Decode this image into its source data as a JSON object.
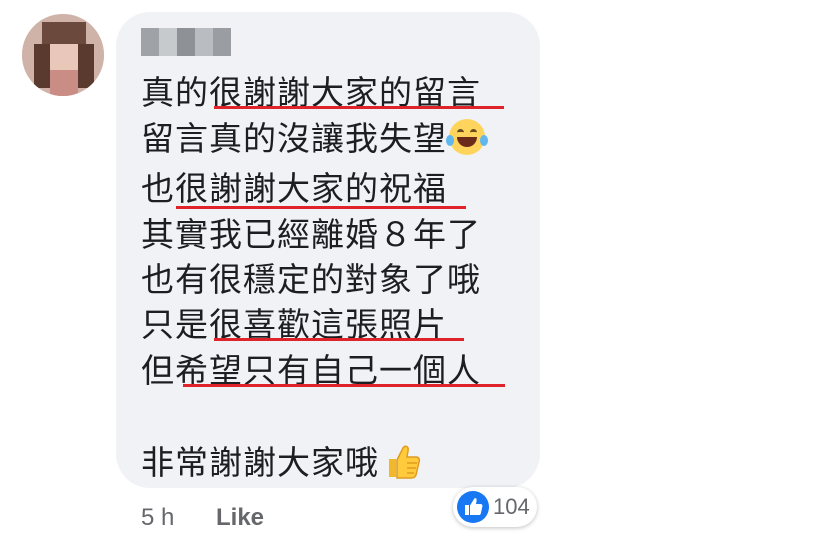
{
  "comment": {
    "lines": [
      "真的很謝謝大家的留言",
      "留言真的沒讓我失望",
      "也很謝謝大家的祝福",
      "其實我已經離婚８年了",
      "也有很穩定的對象了哦",
      "只是很喜歡這張照片",
      "但希望只有自己一個人",
      "",
      "非常謝謝大家哦"
    ],
    "emoji_line_2": "face-with-tears-of-joy-icon",
    "emoji_line_9": "thumbs-up-icon"
  },
  "footer": {
    "time": "5 h",
    "like_label": "Like"
  },
  "reactions": {
    "icon": "like-reaction-icon",
    "count": "104"
  },
  "colors": {
    "bubble": "#f0f2f5",
    "underline": "#e0232b",
    "like_blue": "#1877f2",
    "meta_text": "#65676b"
  }
}
